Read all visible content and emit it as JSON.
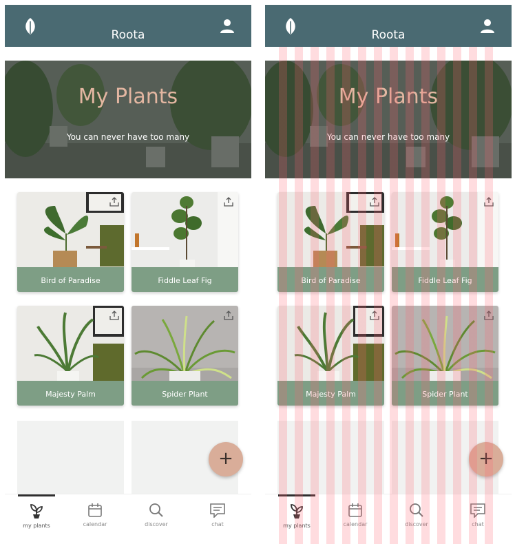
{
  "app": {
    "title": "Roota"
  },
  "hero": {
    "title": "My Plants",
    "subtitle": "You can never have too many"
  },
  "plants": [
    {
      "name": "Bird of Paradise"
    },
    {
      "name": "Fiddle Leaf Fig"
    },
    {
      "name": "Majesty Palm"
    },
    {
      "name": "Spider Plant"
    }
  ],
  "fab": {
    "label": "+"
  },
  "nav": {
    "items": [
      {
        "label": "my plants",
        "icon": "plant-icon",
        "active": true
      },
      {
        "label": "calendar",
        "icon": "calendar-icon",
        "active": false
      },
      {
        "label": "discover",
        "icon": "search-icon",
        "active": false
      },
      {
        "label": "chat",
        "icon": "chat-icon",
        "active": false
      }
    ]
  },
  "colors": {
    "header": "#4a6a72",
    "caption": "#7e9e85",
    "accent": "#d9ad99",
    "hero_title": "#e3b6a1"
  },
  "overlay": {
    "right_screen_stripes": true
  }
}
